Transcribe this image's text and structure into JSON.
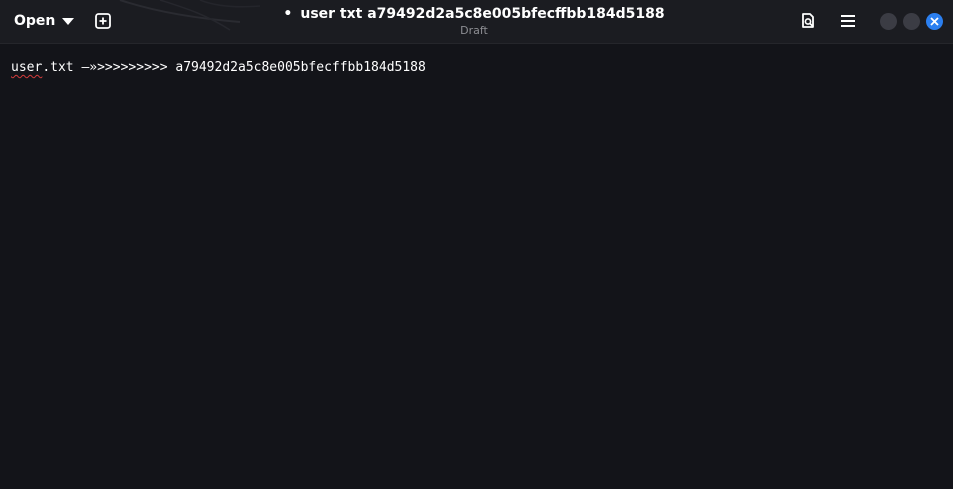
{
  "header": {
    "open_label": "Open",
    "modified_marker": "•",
    "title": "user txt a79492d2a5c8e005bfecffbb184d5188",
    "subtitle": "Draft"
  },
  "icons": {
    "open_menu": "chevron-down-icon",
    "new_document": "new-tab-icon",
    "search": "document-search-icon",
    "menu": "hamburger-menu-icon",
    "minimize": "minimize-icon",
    "maximize": "maximize-icon",
    "close": "close-icon"
  },
  "editor": {
    "word_misspelled": "user",
    "rest_of_filename": ".txt",
    "tab_arrows": " —»>>>>>>>>> ",
    "value": "a79492d2a5c8e005bfecffbb184d5188"
  },
  "colors": {
    "background": "#131419",
    "headerbar": "#1b1c21",
    "close_button": "#2b7ff0",
    "spell_underline": "#d33b3b"
  }
}
